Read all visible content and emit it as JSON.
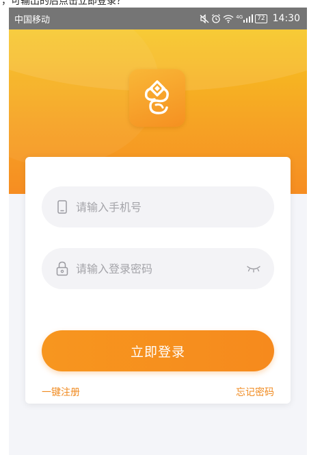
{
  "caption_fragment": "，可输出的后点击立即登录？",
  "status_bar": {
    "carrier": "中国移动",
    "network": "4G",
    "battery": "72",
    "time": "14:30"
  },
  "app": {
    "logo_icon": "app-logo-icon"
  },
  "form": {
    "phone_placeholder": "请输入手机号",
    "password_placeholder": "请输入登录密码",
    "submit_label": "立即登录"
  },
  "links": {
    "register": "一键注册",
    "forgot": "忘记密码"
  },
  "colors": {
    "accent": "#f68d22",
    "link": "#f08a1f",
    "hero_top": "#f7c520",
    "status_bar": "#757575"
  }
}
